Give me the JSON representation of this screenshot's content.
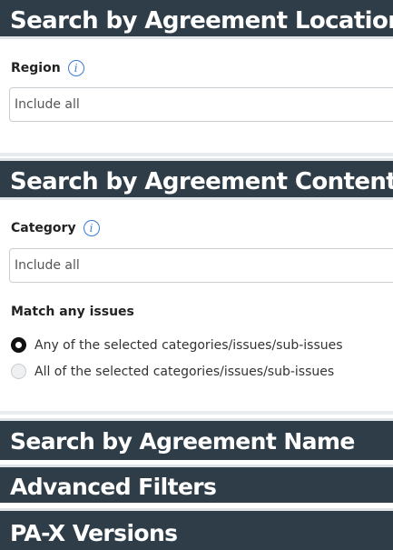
{
  "location_section": {
    "title": "Search by Agreement Location",
    "region_label": "Region",
    "info_glyph": "i",
    "region_select_value": "Include all"
  },
  "content_section": {
    "title": "Search by Agreement Content",
    "category_label": "Category",
    "info_glyph": "i",
    "category_select_value": "Include all",
    "match_label": "Match any issues",
    "options": [
      {
        "label": "Any of the selected categories/issues/sub-issues",
        "selected": true
      },
      {
        "label": "All of the selected categories/issues/sub-issues",
        "selected": false
      }
    ]
  },
  "name_section": {
    "title": "Search by Agreement Name"
  },
  "advanced_section": {
    "title": "Advanced Filters"
  },
  "versions_section": {
    "title": "PA-X Versions"
  },
  "colors": {
    "header_bg": "#2e3d47",
    "header_text": "#ffffff",
    "info_icon": "#3a7bd5"
  },
  "icons": {
    "info": "info-circle-icon"
  }
}
